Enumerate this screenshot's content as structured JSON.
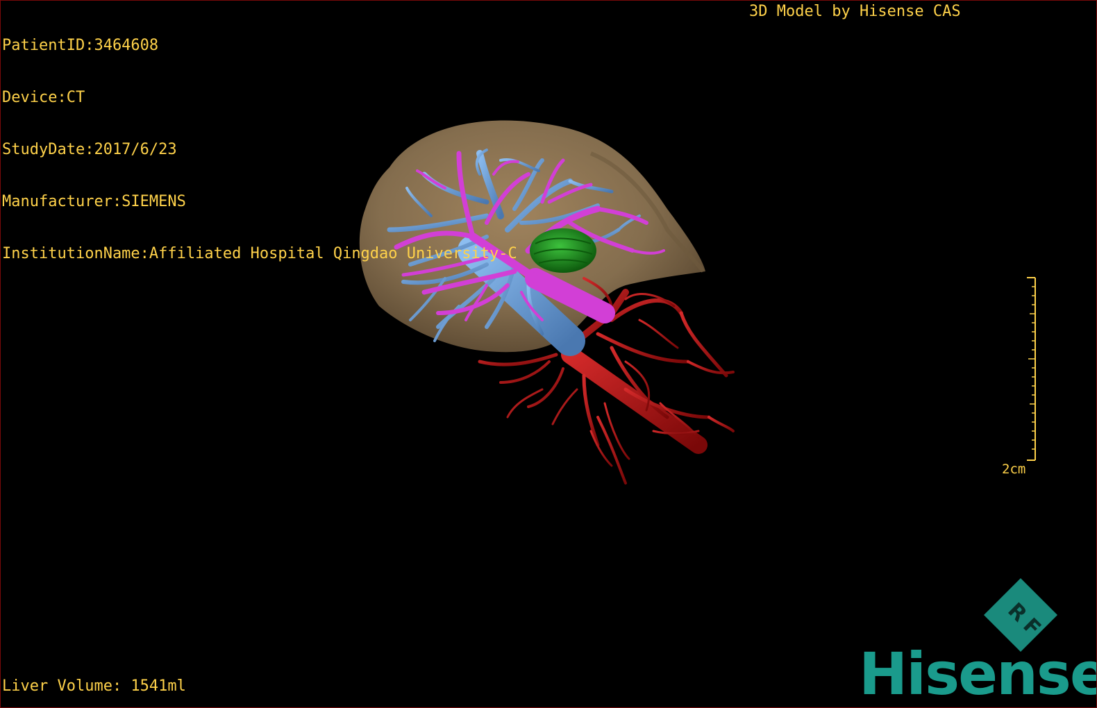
{
  "header": {
    "patient_id": "PatientID:3464608",
    "device": "Device:CT",
    "study_date": "StudyDate:2017/6/23",
    "manufacturer": "Manufacturer:SIEMENS",
    "institution": "InstitutionName:Affiliated Hospital Qingdao University-C"
  },
  "brand": {
    "model_credit": "3D Model by Hisense CAS",
    "logo": "Hisense",
    "orientation_cube_label": "RF"
  },
  "footer": {
    "liver_volume": "Liver Volume: 1541ml"
  },
  "scale": {
    "label": "2cm"
  },
  "colors": {
    "overlay_text": "#ffd24a",
    "liver": "#8b7352",
    "portal_vein": "#d23fd6",
    "hepatic_vein": "#6aa0d8",
    "artery": "#b3101a",
    "lesion": "#1f8f1f",
    "brand": "#1a9b8c"
  },
  "icons": {
    "orientation_cube": "orientation-cube-icon",
    "scale_bar": "scale-bar-icon"
  }
}
